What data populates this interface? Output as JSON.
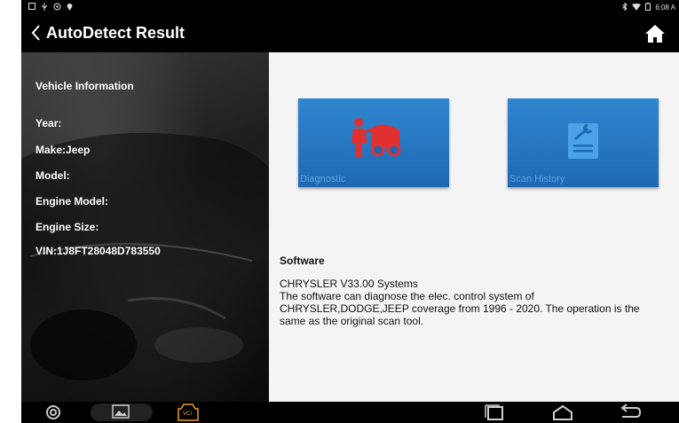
{
  "status_bar": {
    "time": "6:08 A",
    "left_icons": [
      "notification-icon",
      "usb-icon",
      "settings-notification-icon",
      "location-icon"
    ],
    "right_icons": [
      "bluetooth-icon",
      "wifi-icon",
      "battery-icon"
    ]
  },
  "header": {
    "title": "AutoDetect Result",
    "back_icon": "chevron-left-icon",
    "home_icon": "home-icon"
  },
  "vehicle": {
    "title": "Vehicle Information",
    "year": "Year:",
    "make": "Make:Jeep",
    "model": "Model:",
    "engine_model": "Engine Model:",
    "engine_size": "Engine Size:",
    "vin": "VIN:1J8FT28048D783550"
  },
  "tiles": {
    "diagnostic": {
      "label": "Diagnostic",
      "icon": "mechanic-icon"
    },
    "scan_history": {
      "label": "Scan History",
      "icon": "document-wrench-icon"
    }
  },
  "software": {
    "title": "Software",
    "version": "CHRYSLER V33.00 Systems",
    "description": " The software can diagnose the elec. control system of CHRYSLER,DODGE,JEEP coverage from 1996 - 2020. The operation is the same as the original scan tool."
  },
  "nav": {
    "items": [
      "app-icon",
      "screenshot-icon",
      "vci-icon",
      "recent-apps-icon",
      "home-nav-icon",
      "back-nav-icon"
    ],
    "vci_label": "VCI"
  },
  "colors": {
    "tile_blue": "#2a7cc7",
    "accent_orange": "#e8a020",
    "diagnostic_red": "#e03030"
  }
}
